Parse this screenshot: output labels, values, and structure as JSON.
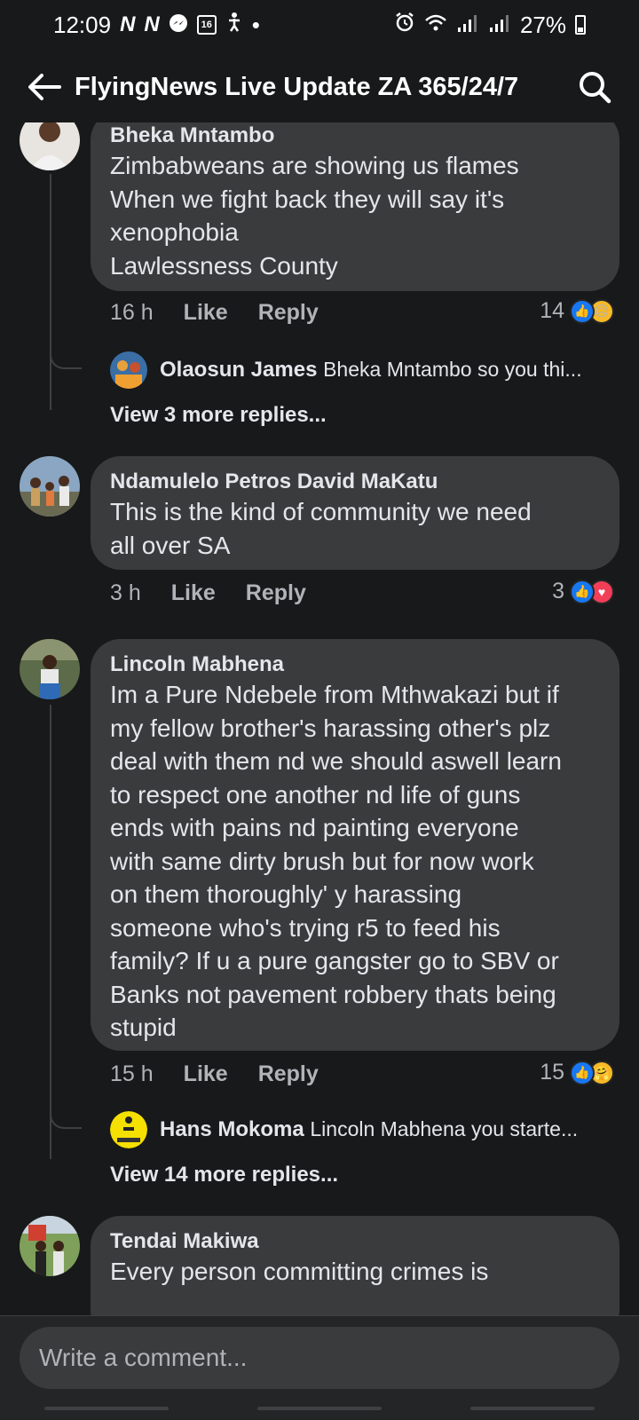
{
  "status_bar": {
    "time": "12:09",
    "notif_n1": "N",
    "notif_n2": "N",
    "calendar_day": "16",
    "battery": "27%"
  },
  "header": {
    "title": "FlyingNews Live Update ZA 365/24/7"
  },
  "comments": [
    {
      "author": "Bheka Mntambo",
      "lines": [
        "Zimbabweans are showing us flames",
        "When we fight back they will say it's",
        "xenophobia",
        "Lawlessness County"
      ],
      "time": "16 h",
      "like": "Like",
      "reply": "Reply",
      "reaction_count": "14",
      "reply_preview": {
        "author": "Olaosun James",
        "text": "Bheka Mntambo so you thi..."
      },
      "view_more": "View 3 more replies..."
    },
    {
      "author": "Ndamulelo Petros David MaKatu",
      "lines": [
        "This is the kind of community we need",
        "all over SA"
      ],
      "time": "3 h",
      "like": "Like",
      "reply": "Reply",
      "reaction_count": "3"
    },
    {
      "author": "Lincoln Mabhena",
      "lines": [
        "Im a Pure Ndebele from Mthwakazi but if",
        "my fellow brother's harassing other's plz",
        "deal with them nd we should aswell learn",
        "to respect one another nd life of guns",
        "ends with pains nd painting everyone",
        "with same dirty brush but for now work",
        "on them thoroughly' y harassing",
        "someone who's trying r5 to feed his",
        "family? If u a pure gangster go to SBV or",
        "Banks not pavement robbery thats being",
        "stupid"
      ],
      "time": "15 h",
      "like": "Like",
      "reply": "Reply",
      "reaction_count": "15",
      "reply_preview": {
        "author": "Hans Mokoma",
        "text": "Lincoln Mabhena  you starte..."
      },
      "view_more": "View 14 more replies..."
    },
    {
      "author": "Tendai Makiwa",
      "lines": [
        "Every person committing crimes is"
      ]
    }
  ],
  "composer": {
    "placeholder": "Write a comment..."
  }
}
